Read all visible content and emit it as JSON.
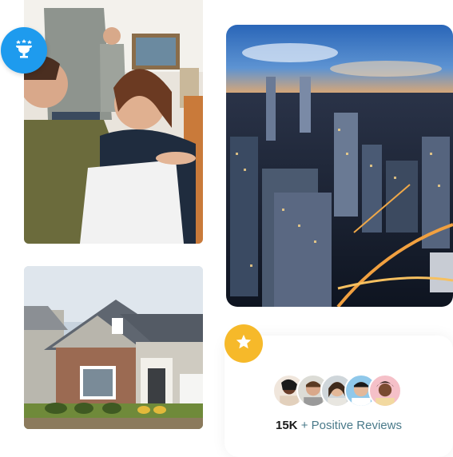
{
  "badges": {
    "trophy": {
      "icon": "trophy-icon",
      "color": "#1e9bee"
    },
    "star": {
      "icon": "star-icon",
      "color": "#f6b92a"
    }
  },
  "images": {
    "people": "people-meeting-photo",
    "house": "house-exterior-photo",
    "city": "city-skyline-photo"
  },
  "reviews": {
    "count": "15K",
    "label": "+ Positive Reviews",
    "avatars": [
      "avatar-1",
      "avatar-2",
      "avatar-3",
      "avatar-4",
      "avatar-5"
    ]
  },
  "colors": {
    "accent_blue": "#1e9bee",
    "accent_gold": "#f6b92a",
    "review_label": "#4a7a8a"
  }
}
